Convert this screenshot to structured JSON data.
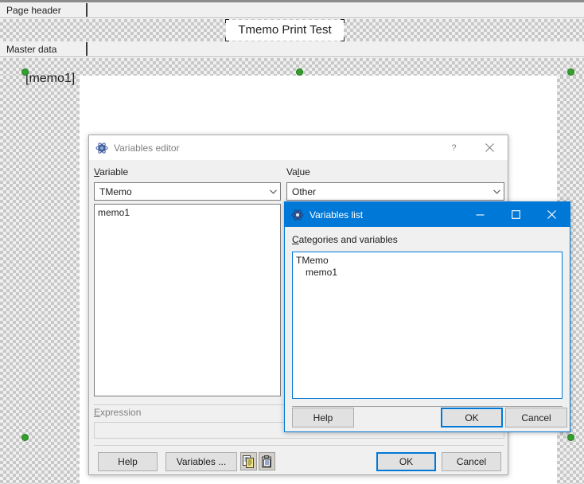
{
  "designer": {
    "bands": [
      {
        "name": "page-header",
        "label": "Page header"
      },
      {
        "name": "master-data",
        "label": "Master data"
      }
    ],
    "objects": [
      {
        "name": "title-memo",
        "text": "Tmemo Print Test"
      },
      {
        "name": "memo1-object",
        "text": "[memo1]"
      }
    ]
  },
  "variables_editor": {
    "title": "Variables editor",
    "icon": "app-icon",
    "help_glyph": "?",
    "close_glyph": "✕",
    "variable_label": "Variable",
    "variable_label_accel": "V",
    "variable_value": "TMemo",
    "value_label": "Value",
    "value_label_accel": "l",
    "value_value": "Other",
    "list_items": [
      "memo1"
    ],
    "expression_label": "Expression",
    "expression_value": "",
    "buttons": {
      "help": "Help",
      "variables": "Variables ...",
      "copy_icon": "copy-icon",
      "paste_icon": "paste-icon",
      "ok": "OK",
      "cancel": "Cancel"
    }
  },
  "variables_list": {
    "title": "Variables list",
    "icon": "app-icon",
    "minimize_glyph": "—",
    "maximize_glyph": "☐",
    "close_glyph": "✕",
    "categories_label": "Categories and variables",
    "categories_accel": "C",
    "tree": [
      {
        "label": "TMemo",
        "level": 0
      },
      {
        "label": "memo1",
        "level": 1
      }
    ],
    "buttons": {
      "help": "Help",
      "ok": "OK",
      "cancel": "Cancel"
    }
  },
  "colors": {
    "title_active": "#0078d7",
    "handle_green": "#33a02c",
    "dialog_bg": "#f0f0f0"
  }
}
